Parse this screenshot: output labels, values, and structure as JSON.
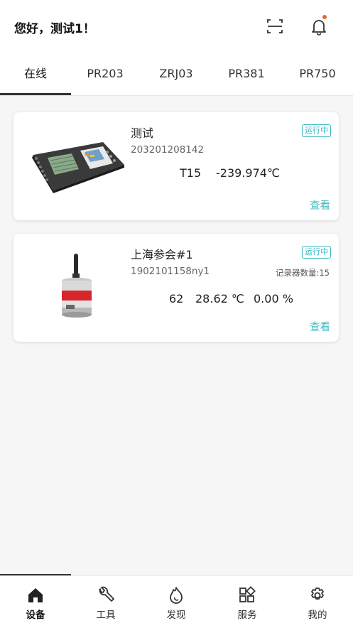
{
  "header": {
    "greeting": "您好，测试1！",
    "scan_icon": "scan-icon",
    "bell_icon": "bell-icon",
    "notification_dot_color": "#e8643a"
  },
  "tabs": [
    "在线",
    "PR203",
    "ZRJ03",
    "PR381",
    "PR750"
  ],
  "devices": [
    {
      "name": "测试",
      "serial": "203201208142",
      "status": "运行中",
      "reading_channel": "T15",
      "reading_value": "-239.974℃",
      "view": "查看"
    },
    {
      "name": "上海参会#1",
      "serial": "1902101158ny1",
      "status": "运行中",
      "recorder_count": "记录器数量:15",
      "reading_a": "62",
      "reading_b": "28.62 ℃",
      "reading_c": "0.00 %",
      "view": "查看"
    }
  ],
  "bottom_nav": [
    {
      "label": "设备",
      "icon": "home-icon"
    },
    {
      "label": "工具",
      "icon": "wrench-icon"
    },
    {
      "label": "发现",
      "icon": "flame-icon"
    },
    {
      "label": "服务",
      "icon": "apps-icon"
    },
    {
      "label": "我的",
      "icon": "gear-icon"
    }
  ],
  "accent_color": "#3cb8c1"
}
